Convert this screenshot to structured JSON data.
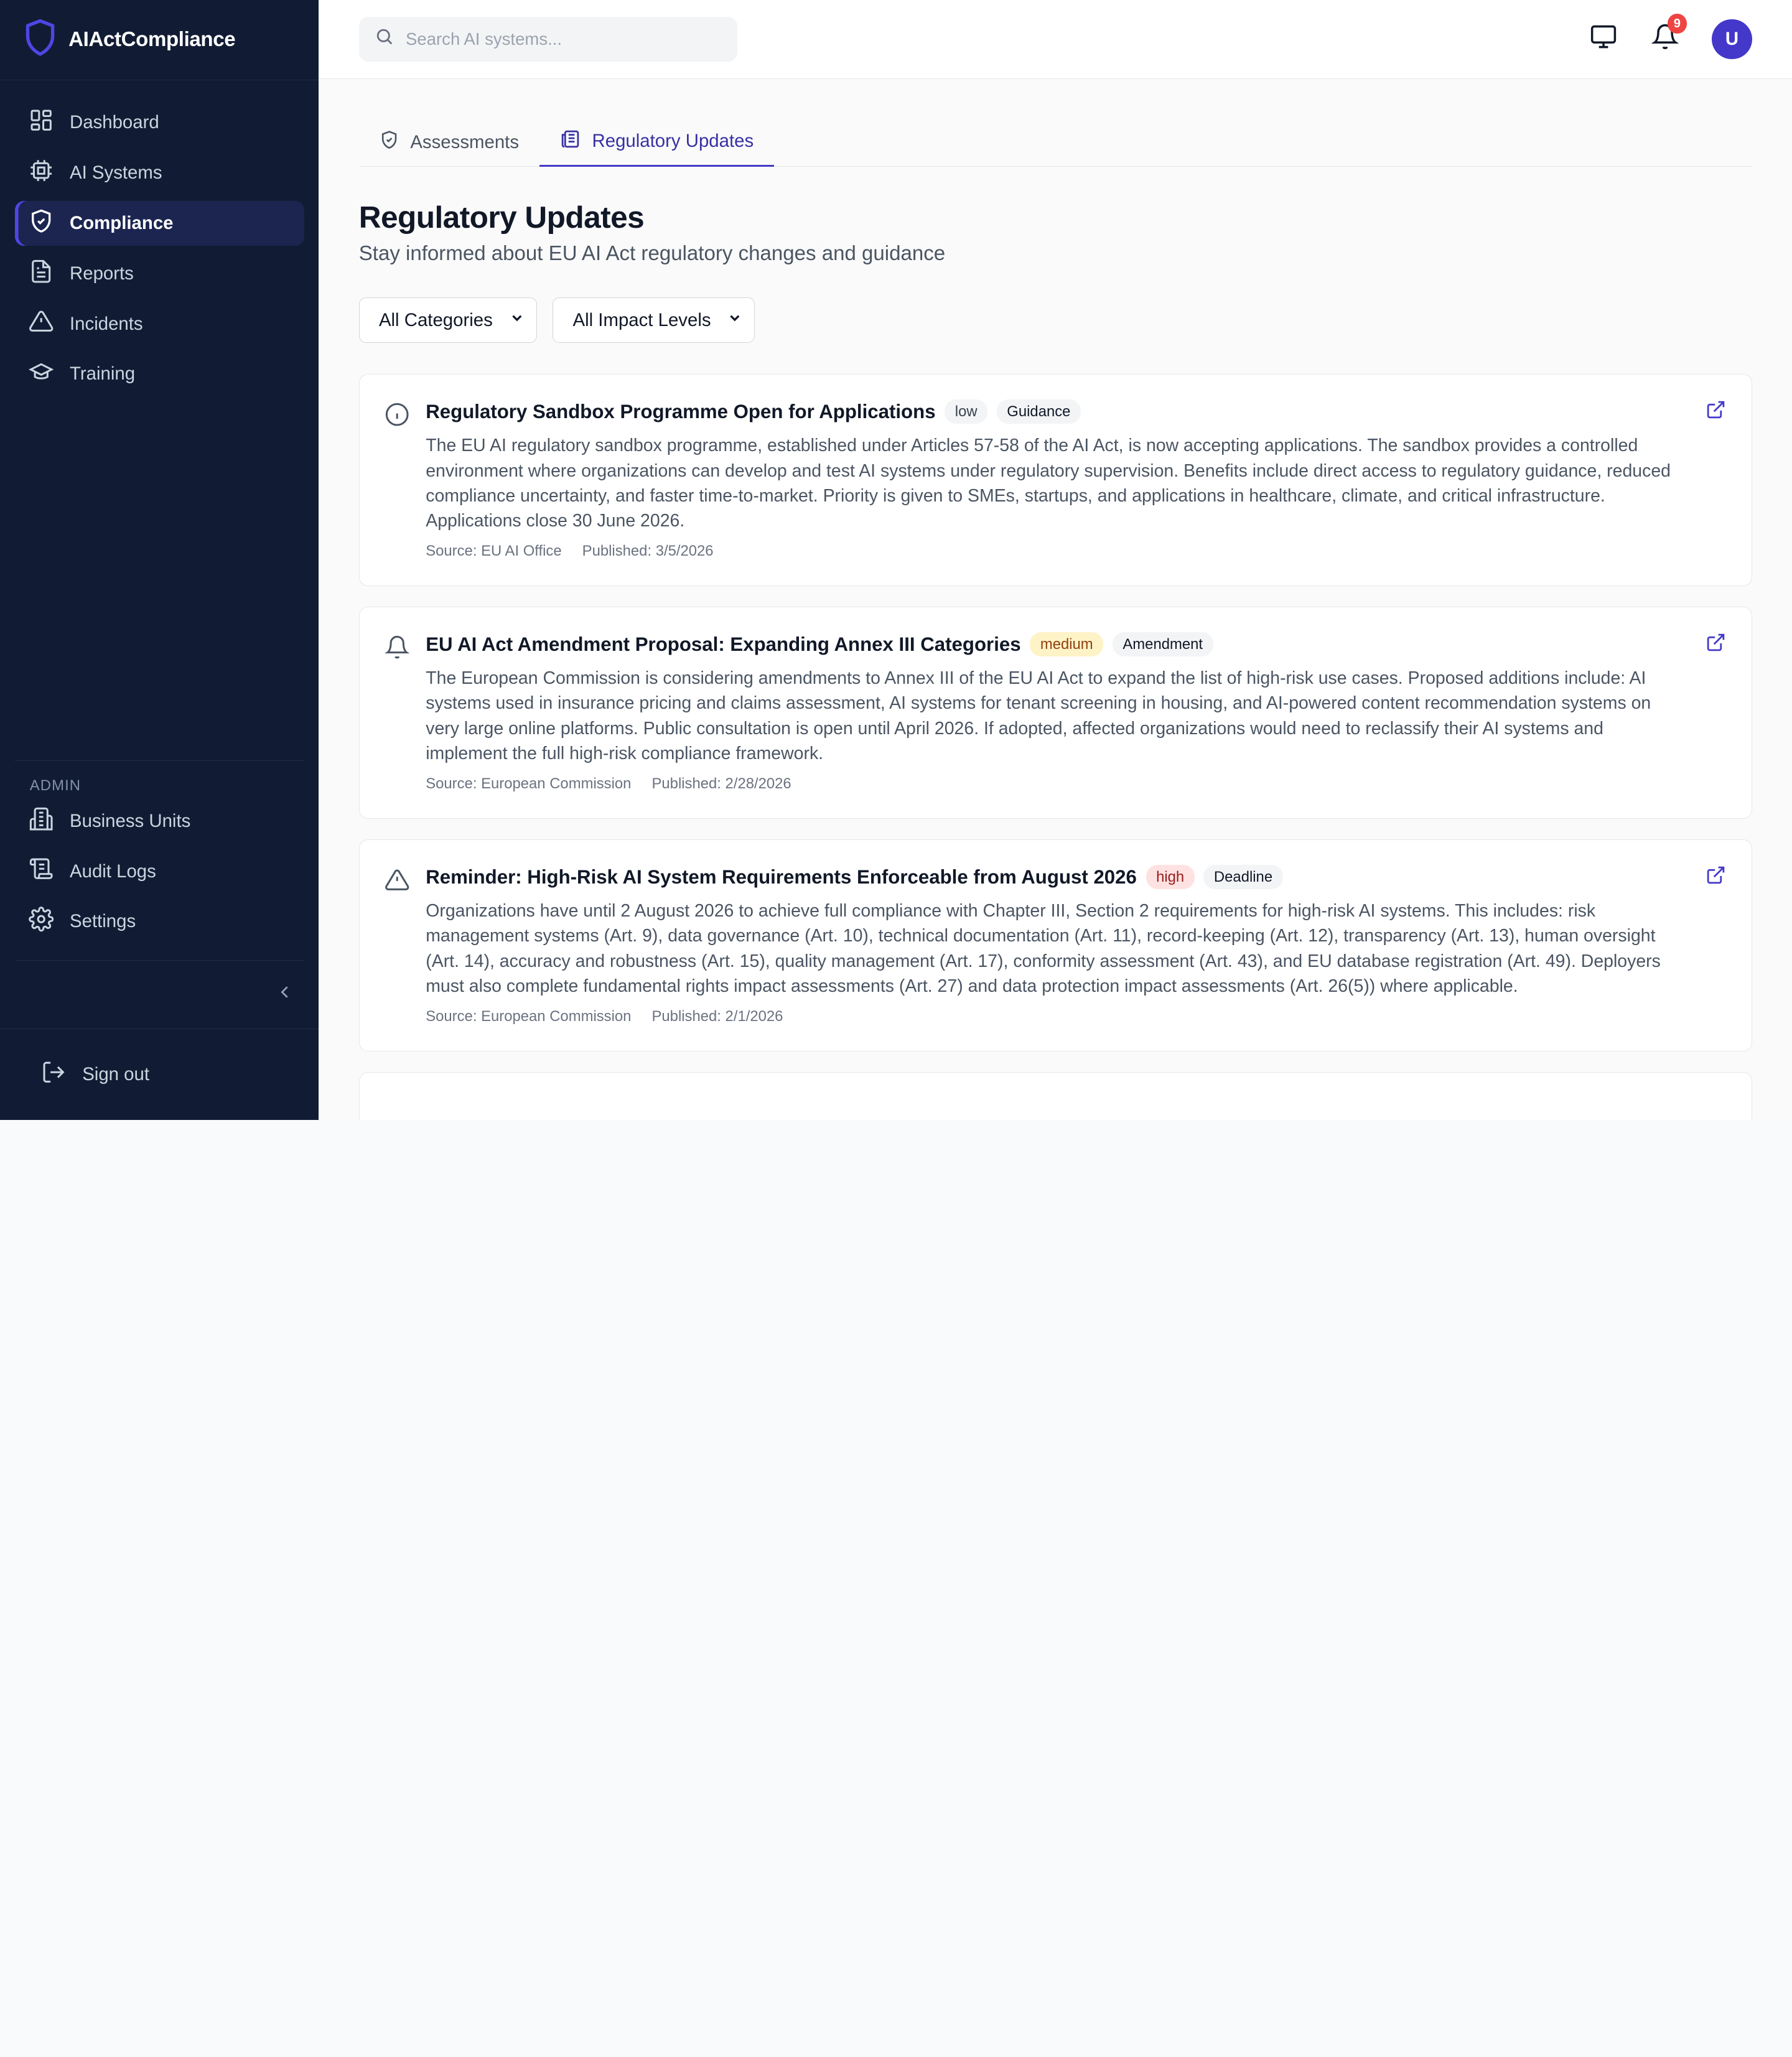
{
  "app": {
    "name": "AIActCompliance"
  },
  "sidebar": {
    "items": [
      {
        "label": "Dashboard",
        "icon": "dashboard-icon"
      },
      {
        "label": "AI Systems",
        "icon": "cpu-icon"
      },
      {
        "label": "Compliance",
        "icon": "shield-check-icon",
        "active": true
      },
      {
        "label": "Reports",
        "icon": "file-text-icon"
      },
      {
        "label": "Incidents",
        "icon": "alert-triangle-icon"
      },
      {
        "label": "Training",
        "icon": "graduation-cap-icon"
      }
    ],
    "admin_label": "ADMIN",
    "admin_items": [
      {
        "label": "Business Units",
        "icon": "building-icon"
      },
      {
        "label": "Audit Logs",
        "icon": "logs-icon"
      },
      {
        "label": "Settings",
        "icon": "gear-icon"
      }
    ],
    "sign_out": "Sign out"
  },
  "topbar": {
    "search_placeholder": "Search AI systems...",
    "notification_count": "9",
    "avatar_initial": "U"
  },
  "tabs": [
    {
      "label": "Assessments",
      "active": false
    },
    {
      "label": "Regulatory Updates",
      "active": true
    }
  ],
  "page": {
    "title": "Regulatory Updates",
    "subtitle": "Stay informed about EU AI Act regulatory changes and guidance"
  },
  "filters": {
    "category": "All Categories",
    "impact": "All Impact Levels"
  },
  "updates": [
    {
      "icon": "info-icon",
      "title": "Regulatory Sandbox Programme Open for Applications",
      "impact": "low",
      "category": "Guidance",
      "description": "The EU AI regulatory sandbox programme, established under Articles 57-58 of the AI Act, is now accepting applications. The sandbox provides a controlled environment where organizations can develop and test AI systems under regulatory supervision. Benefits include direct access to regulatory guidance, reduced compliance uncertainty, and faster time-to-market. Priority is given to SMEs, startups, and applications in healthcare, climate, and critical infrastructure. Applications close 30 June 2026.",
      "source": "Source: EU AI Office",
      "published": "Published: 3/5/2026"
    },
    {
      "icon": "bell-icon",
      "title": "EU AI Act Amendment Proposal: Expanding Annex III Categories",
      "impact": "medium",
      "category": "Amendment",
      "description": "The European Commission is considering amendments to Annex III of the EU AI Act to expand the list of high-risk use cases. Proposed additions include: AI systems used in insurance pricing and claims assessment, AI systems for tenant screening in housing, and AI-powered content recommendation systems on very large online platforms. Public consultation is open until April 2026. If adopted, affected organizations would need to reclassify their AI systems and implement the full high-risk compliance framework.",
      "source": "Source: European Commission",
      "published": "Published: 2/28/2026"
    },
    {
      "icon": "alert-triangle-icon",
      "title": "Reminder: High-Risk AI System Requirements Enforceable from August 2026",
      "impact": "high",
      "category": "Deadline",
      "description": "Organizations have until 2 August 2026 to achieve full compliance with Chapter III, Section 2 requirements for high-risk AI systems. This includes: risk management systems (Art. 9), data governance (Art. 10), technical documentation (Art. 11), record-keeping (Art. 12), transparency (Art. 13), human oversight (Art. 14), accuracy and robustness (Art. 15), quality management (Art. 17), conformity assessment (Art. 43), and EU database registration (Art. 49). Deployers must also complete fundamental rights impact assessments (Art. 27) and data protection impact assessments (Art. 26(5)) where applicable.",
      "source": "Source: European Commission",
      "published": "Published: 2/1/2026"
    }
  ],
  "colors": {
    "sidebar_bg": "#111c34",
    "accent": "#4338ca",
    "badge": "#ef4444"
  }
}
